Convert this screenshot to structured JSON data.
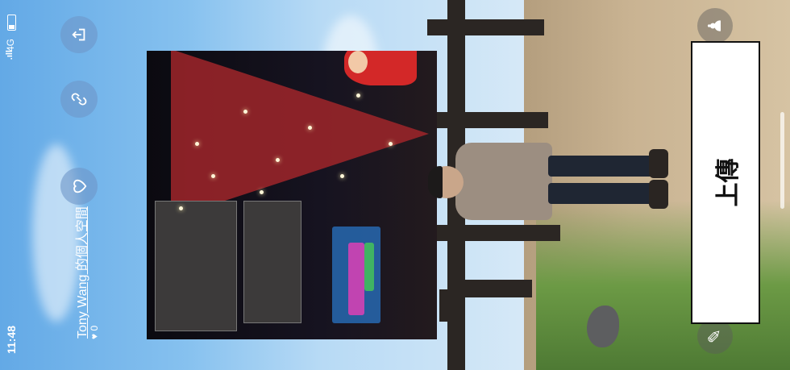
{
  "status": {
    "time": "11:48",
    "network": "4G",
    "signal": ".ıll"
  },
  "header": {
    "title": "Tony Wang 的個人空間",
    "likes_count": "0"
  },
  "actions": {
    "share_icon": "share-icon",
    "link_icon": "link-icon",
    "like_icon": "heart-icon"
  },
  "upload": {
    "label": "上傳"
  },
  "side_icons": {
    "top": "avatar-icon",
    "bottom": "mic-icon"
  },
  "colors": {
    "sky": "#86c1ef",
    "ground": "#c9b392",
    "button_bg": "#ffffff"
  }
}
